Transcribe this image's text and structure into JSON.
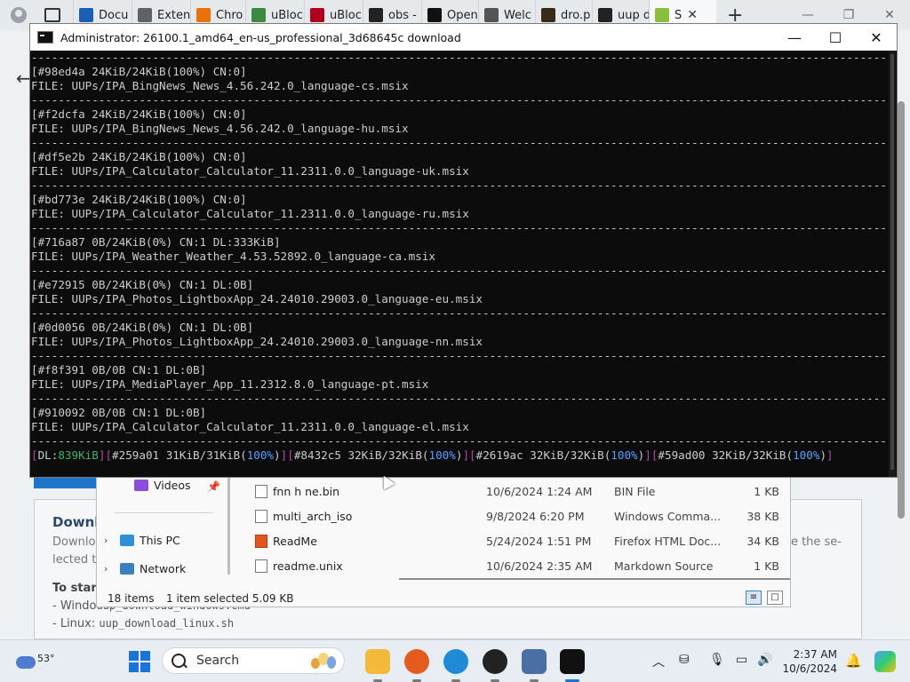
{
  "browser": {
    "tabs": [
      {
        "label": "Docu",
        "favicon_color": "#1a5fb4",
        "favicon": "docs-icon"
      },
      {
        "label": "Exten",
        "favicon_color": "#5f6368",
        "favicon": "puzzle-icon"
      },
      {
        "label": "Chro",
        "favicon_color": "#e8710a",
        "favicon": "chrome-icon"
      },
      {
        "label": "uBloc",
        "favicon_color": "#3b8a3e",
        "favicon": "grid-icon"
      },
      {
        "label": "uBloc",
        "favicon_color": "#b00020",
        "favicon": "ublock-icon"
      },
      {
        "label": "obs -",
        "favicon_color": "#222222",
        "favicon": "search-icon"
      },
      {
        "label": "Open",
        "favicon_color": "#111111",
        "favicon": "openai-icon"
      },
      {
        "label": "Welc",
        "favicon_color": "#555555",
        "favicon": "page-icon"
      },
      {
        "label": "dro.p",
        "favicon_color": "#3a2a1a",
        "favicon": "image-icon"
      },
      {
        "label": "uup d",
        "favicon_color": "#222222",
        "favicon": "search-icon"
      },
      {
        "label": "S",
        "favicon_color": "#8bbf3b",
        "favicon": "uup-icon"
      }
    ],
    "new_tab": "+",
    "tab_close": "✕"
  },
  "page": {
    "card_title": "Downl",
    "card_desc_left_1": "Downlo",
    "card_desc_left_2": "lected ta",
    "card_desc_right_1": "ave the se-",
    "card_start": "To start",
    "card_line1_prefix": "- Windo",
    "card_line1_code": "uup_download_windows.cmd",
    "card_line2_prefix": "- Linux: ",
    "card_line2_code": "uup_download_linux.sh"
  },
  "explorer": {
    "nav": [
      {
        "label": "Videos",
        "icon": "videos-icon",
        "color": "#8a4fd8",
        "has_chevron": false,
        "pinned": true
      },
      {
        "label": "This PC",
        "icon": "this-pc-icon",
        "color": "#2f8fd8",
        "has_chevron": true,
        "pinned": false
      },
      {
        "label": "Network",
        "icon": "network-icon",
        "color": "#3a7fc0",
        "has_chevron": true,
        "pinned": false
      }
    ],
    "files": [
      {
        "name": "fnn h ne.bin",
        "date": "10/6/2024 1:24 AM",
        "type": "BIN File",
        "size": "1 KB",
        "icon": "file-icon"
      },
      {
        "name": "multi_arch_iso",
        "date": "9/8/2024 6:20 PM",
        "type": "Windows Comma...",
        "size": "38 KB",
        "icon": "cmd-file-icon"
      },
      {
        "name": "ReadMe",
        "date": "5/24/2024 1:51 PM",
        "type": "Firefox HTML Doc...",
        "size": "34 KB",
        "icon": "html-file-icon"
      },
      {
        "name": "readme.unix",
        "date": "10/6/2024 2:35 AM",
        "type": "Markdown Source",
        "size": "1 KB",
        "icon": "file-icon"
      }
    ],
    "status_count": "18 items",
    "status_selected": "1 item selected  5.09 KB"
  },
  "console": {
    "title": "Administrator:  26100.1_amd64_en-us_professional_3d68645c download",
    "separator": "----------------------------------------------------------------------------------------------------------------------------------------------",
    "entries": [
      {
        "status": "[#98ed4a 24KiB/24KiB(100%) CN:0]",
        "file": "FILE: UUPs/IPA_BingNews_News_4.56.242.0_language-cs.msix"
      },
      {
        "status": "[#f2dcfa 24KiB/24KiB(100%) CN:0]",
        "file": "FILE: UUPs/IPA_BingNews_News_4.56.242.0_language-hu.msix"
      },
      {
        "status": "[#df5e2b 24KiB/24KiB(100%) CN:0]",
        "file": "FILE: UUPs/IPA_Calculator_Calculator_11.2311.0.0_language-uk.msix"
      },
      {
        "status": "[#bd773e 24KiB/24KiB(100%) CN:0]",
        "file": "FILE: UUPs/IPA_Calculator_Calculator_11.2311.0.0_language-ru.msix"
      },
      {
        "status": "[#716a87 0B/24KiB(0%) CN:1 DL:333KiB]",
        "file": "FILE: UUPs/IPA_Weather_Weather_4.53.52892.0_language-ca.msix"
      },
      {
        "status": "[#e72915 0B/24KiB(0%) CN:1 DL:0B]",
        "file": "FILE: UUPs/IPA_Photos_LightboxApp_24.24010.29003.0_language-eu.msix"
      },
      {
        "status": "[#0d0056 0B/24KiB(0%) CN:1 DL:0B]",
        "file": "FILE: UUPs/IPA_Photos_LightboxApp_24.24010.29003.0_language-nn.msix"
      },
      {
        "status": "[#f8f391 0B/0B CN:1 DL:0B]",
        "file": "FILE: UUPs/IPA_MediaPlayer_App_11.2312.8.0_language-pt.msix"
      },
      {
        "status": "[#910092 0B/0B CN:1 DL:0B]",
        "file": "FILE: UUPs/IPA_Calculator_Calculator_11.2311.0.0_language-el.msix"
      }
    ],
    "status_line": {
      "dl_label": "DL:",
      "dl_value": "839KiB",
      "items": [
        {
          "id": "#259a01",
          "progress": "31KiB/31KiB",
          "pct": "100%"
        },
        {
          "id": "#8432c5",
          "progress": "32KiB/32KiB",
          "pct": "100%"
        },
        {
          "id": "#2619ac",
          "progress": "32KiB/32KiB",
          "pct": "100%"
        },
        {
          "id": "#59ad00",
          "progress": "32KiB/32KiB",
          "pct": "100%"
        }
      ]
    },
    "controls": {
      "minimize": "—",
      "maximize": "☐",
      "close": "✕"
    }
  },
  "taskbar": {
    "weather_temp": "53°",
    "search_placeholder": "Search",
    "clock_time": "2:37 AM",
    "clock_date": "10/6/2024",
    "apps": [
      {
        "name": "file-explorer-icon",
        "color": "#f2b93b"
      },
      {
        "name": "firefox-icon",
        "color": "#e35b1f"
      },
      {
        "name": "edge-icon",
        "color": "#1f8bd6"
      },
      {
        "name": "obs-icon",
        "color": "#222222"
      },
      {
        "name": "network-tool-icon",
        "color": "#4a6fa5"
      },
      {
        "name": "terminal-icon",
        "color": "#111111"
      }
    ]
  }
}
